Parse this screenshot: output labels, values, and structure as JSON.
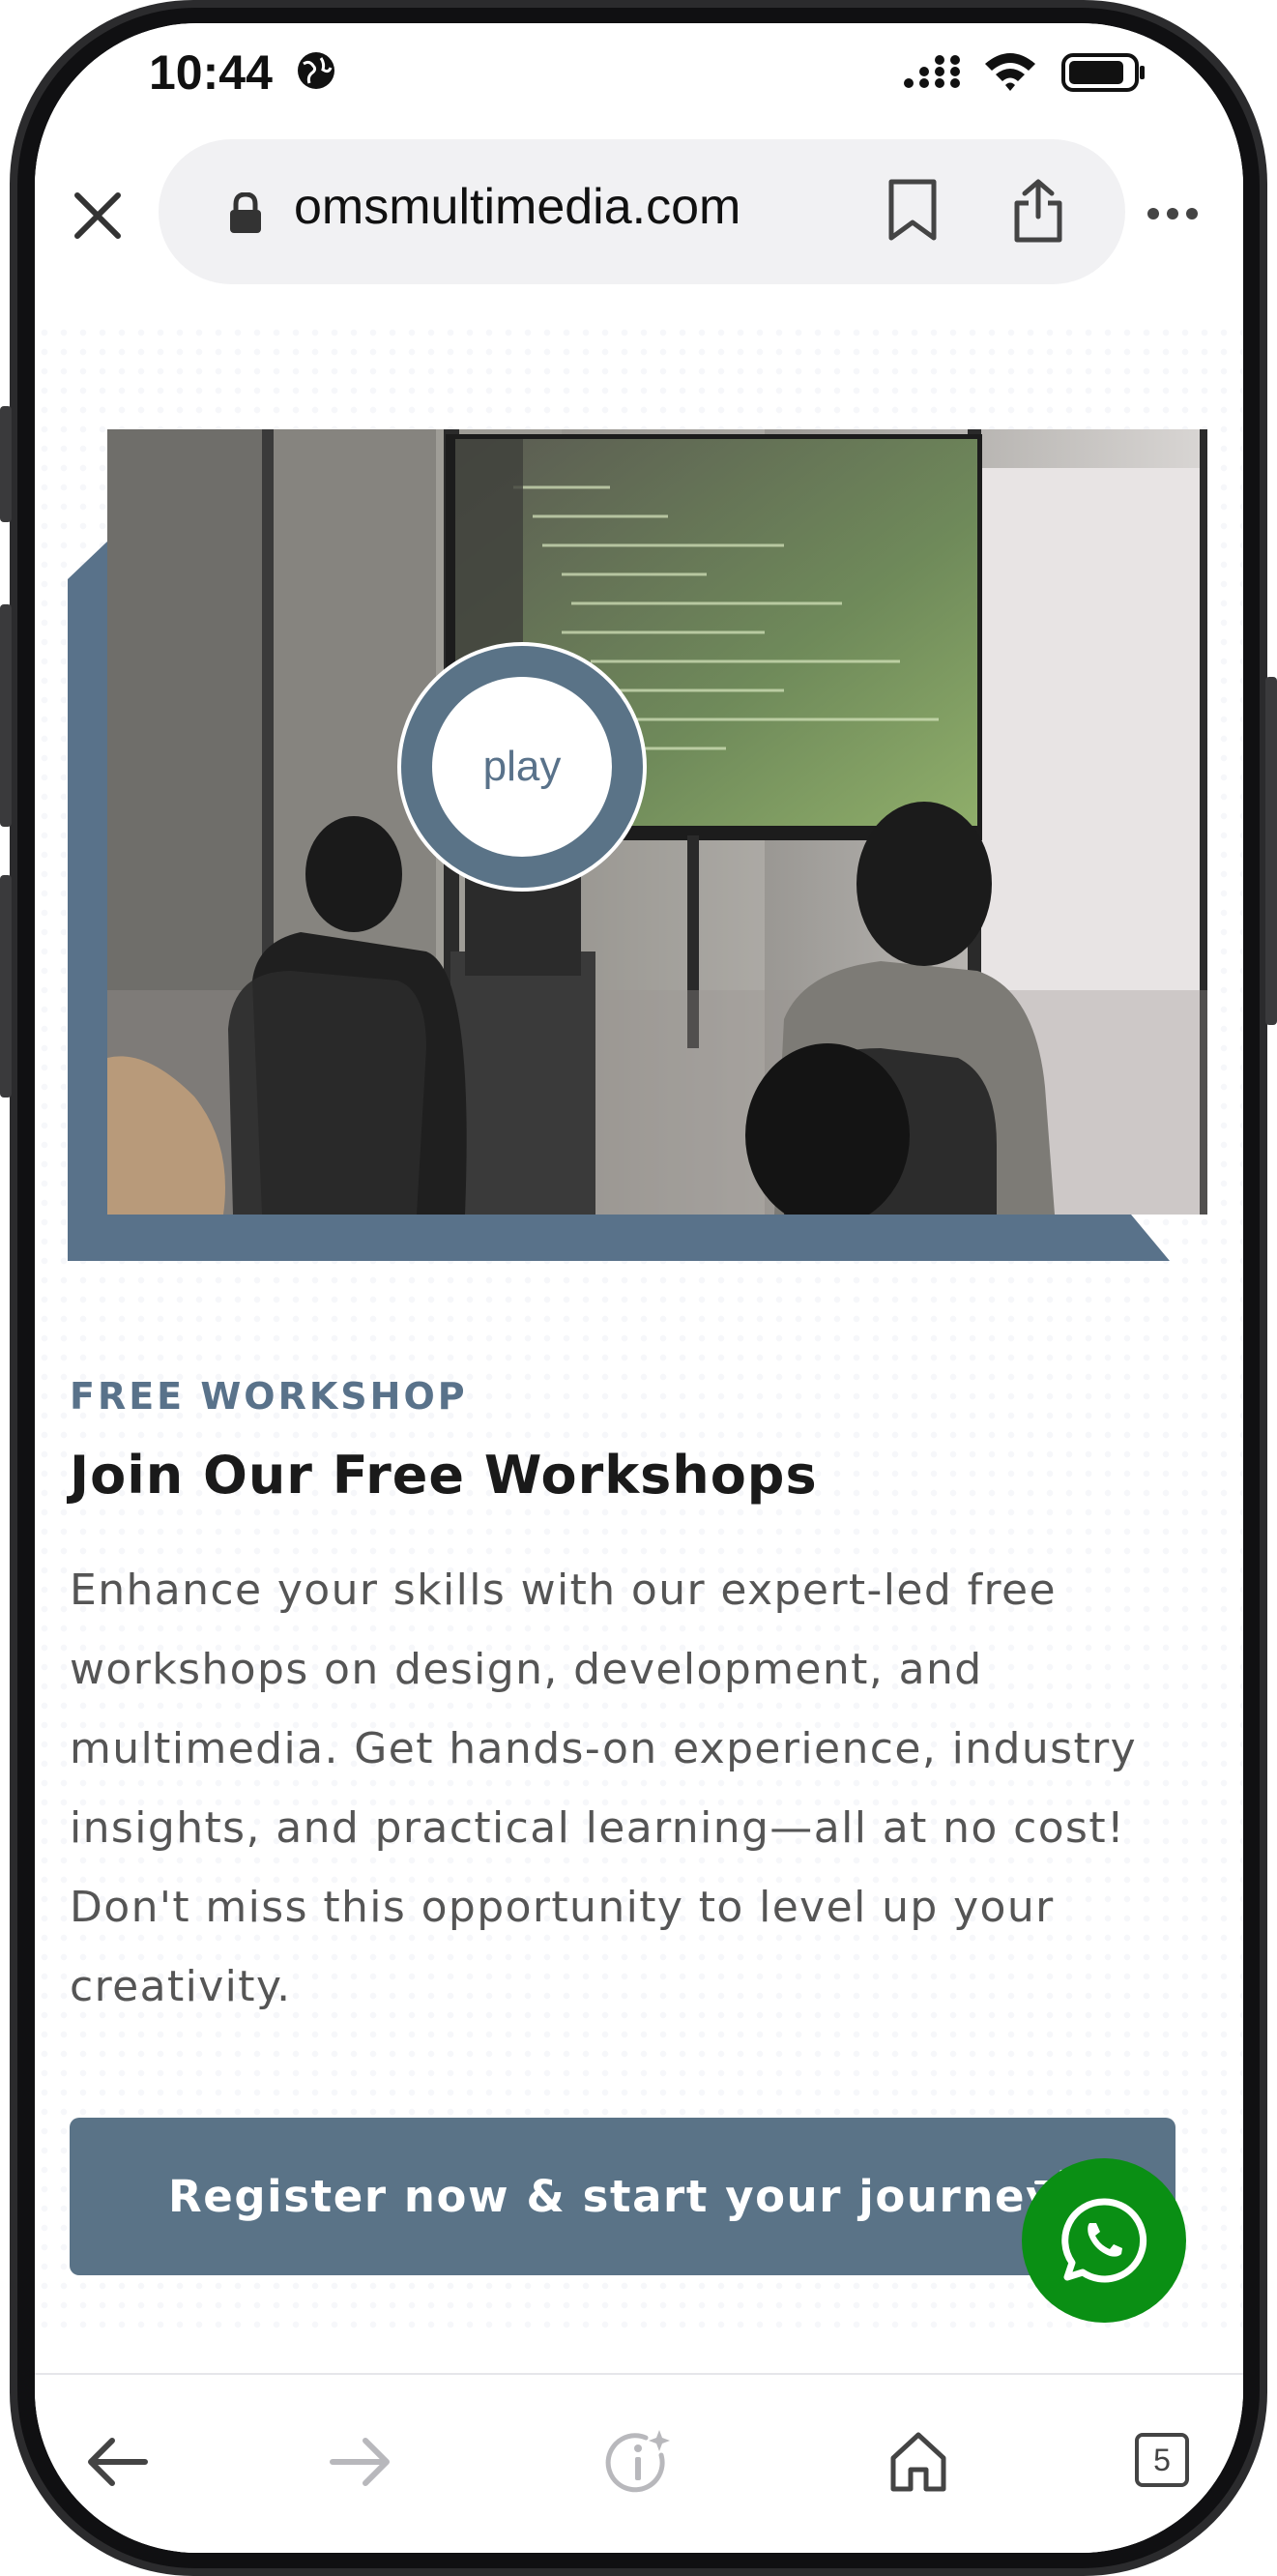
{
  "status_bar": {
    "time": "10:44",
    "globe_icon": "globe-icon",
    "signal_icon": "cellular-signal-icon",
    "wifi_icon": "wifi-icon",
    "battery_icon": "battery-icon"
  },
  "browser": {
    "url": "omsmultimedia.com",
    "close_icon": "close-icon",
    "lock_icon": "lock-icon",
    "bookmark_icon": "bookmark-icon",
    "share_icon": "share-icon",
    "more_icon": "more-icon"
  },
  "media": {
    "play_label": "play"
  },
  "content": {
    "eyebrow": "FREE WORKSHOP",
    "title": "Join Our Free Workshops",
    "body": "Enhance your skills with our expert-led free workshops on design, development, and multimedia. Get hands-on experience, industry insights, and practical learning—all at no cost! Don't miss this opportunity to level up your creativity.",
    "cta_label": "Register now & start your journey!",
    "cta_arrow_icon": "arrow-right-icon"
  },
  "floating": {
    "whatsapp_icon": "whatsapp-icon"
  },
  "toolbar": {
    "back_icon": "back-arrow-icon",
    "forward_icon": "forward-arrow-icon",
    "info_icon": "page-info-icon",
    "home_icon": "home-icon",
    "tabs_count": "5"
  },
  "colors": {
    "accent": "#59728a",
    "whatsapp": "#0a8f14",
    "text_dark": "#1a1a1a",
    "text_body": "#555555"
  }
}
